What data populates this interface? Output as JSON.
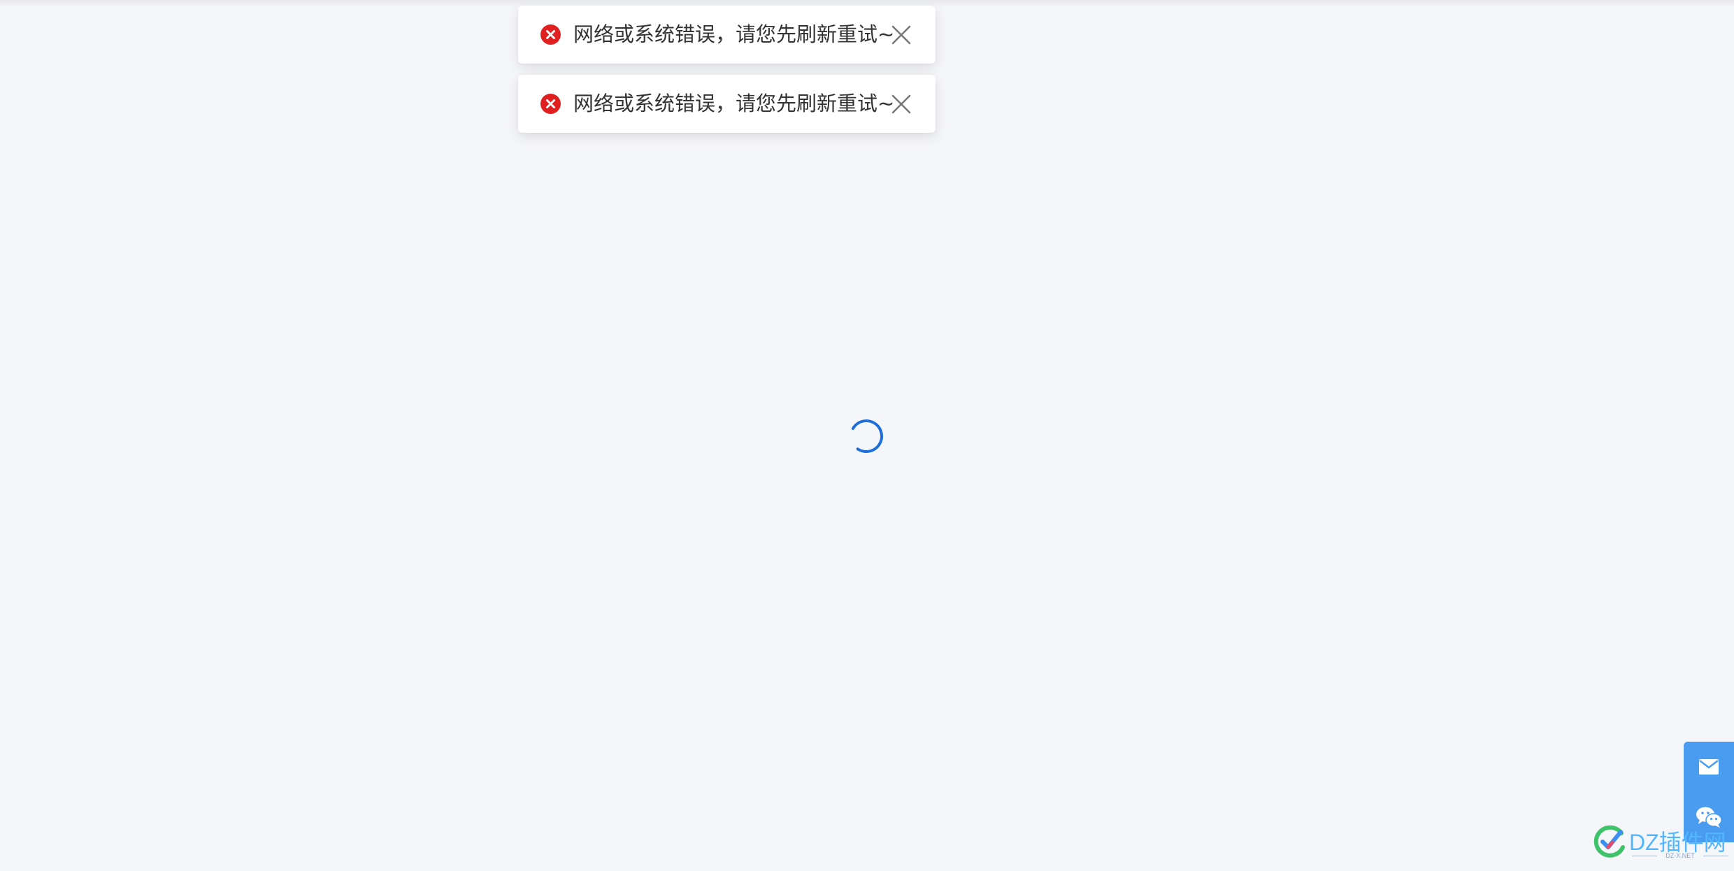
{
  "toasts": [
    {
      "message": "网络或系统错误，请您先刷新重试~",
      "icon": "error-circle-icon",
      "close_icon": "close-icon"
    },
    {
      "message": "网络或系统错误，请您先刷新重试~",
      "icon": "error-circle-icon",
      "close_icon": "close-icon"
    }
  ],
  "loading": {
    "icon": "loading-spinner-icon"
  },
  "side_toolbar": {
    "buttons": [
      {
        "icon": "mail-icon"
      },
      {
        "icon": "wechat-icon"
      }
    ]
  },
  "watermark": {
    "text": "DZ插件网",
    "sub_text": "DZ-X.NET"
  },
  "colors": {
    "background": "#f5f6fa",
    "error": "#e02020",
    "spinner": "#1e6fdc",
    "side_toolbar": "#4a9cf0",
    "watermark": "#52b6ff"
  }
}
